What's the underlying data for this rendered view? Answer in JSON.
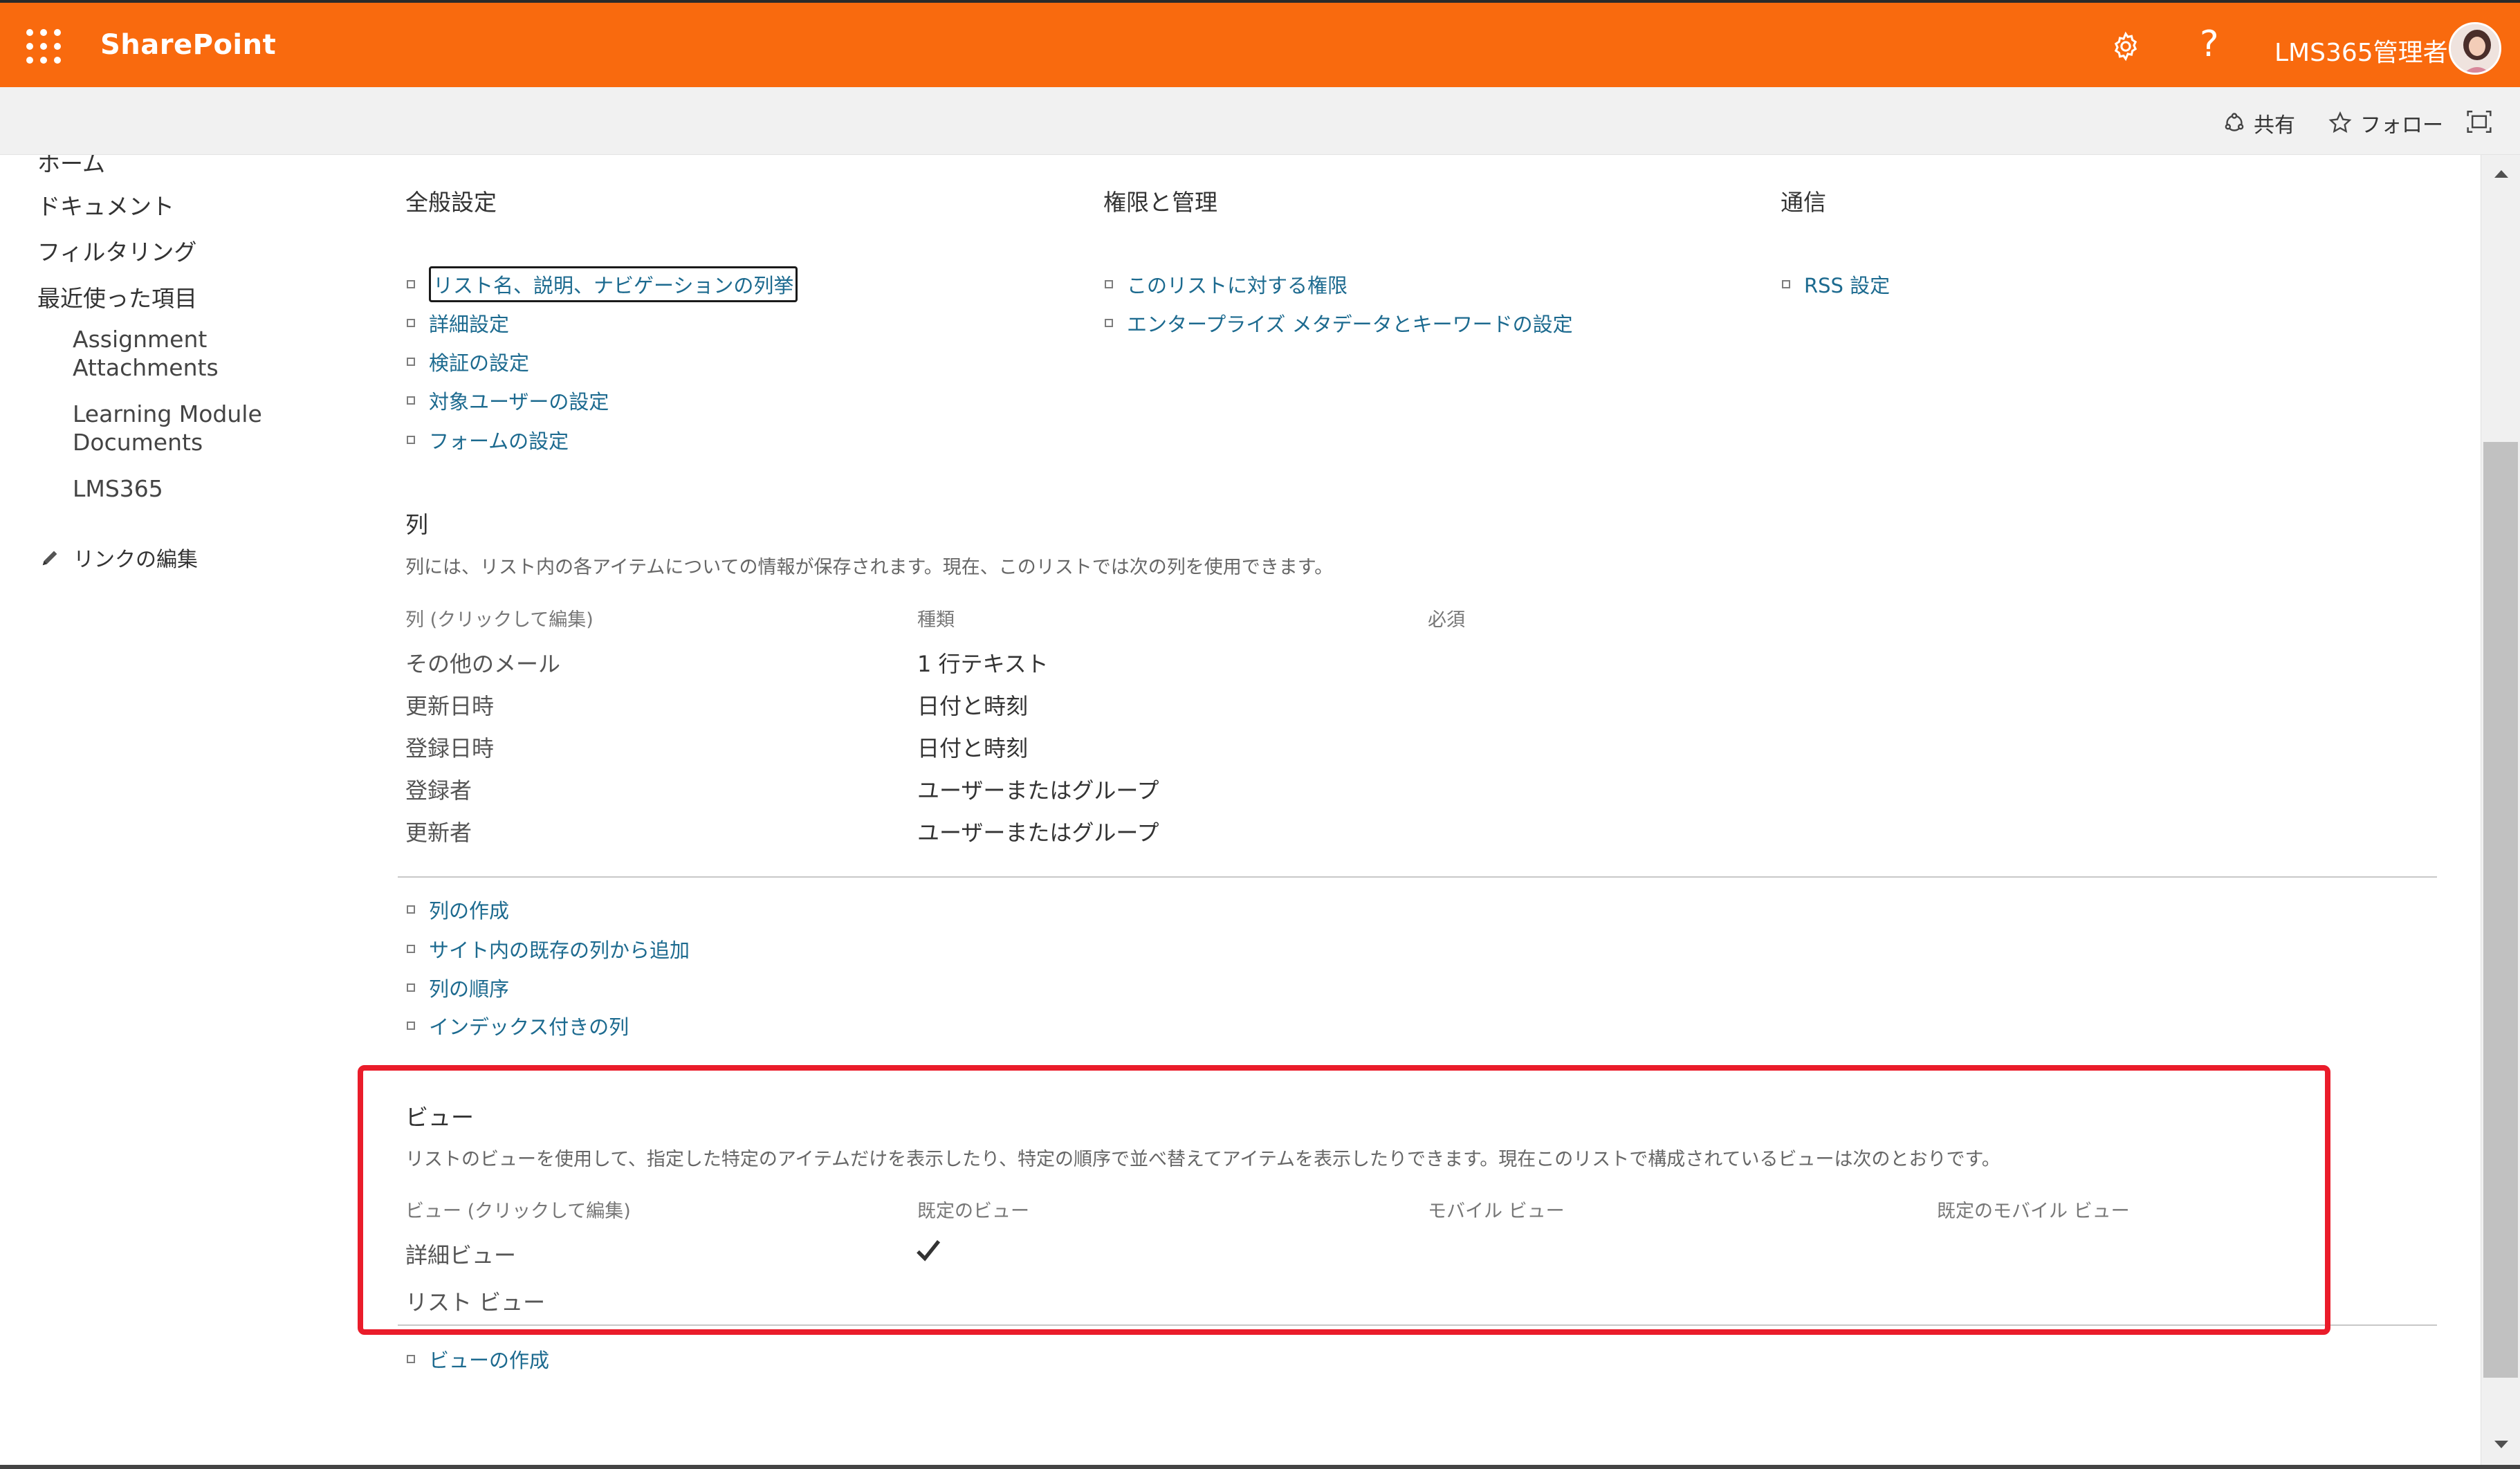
{
  "header": {
    "app_name": "SharePoint",
    "help_label": "?",
    "user_name": "LMS365管理者",
    "brand_color": "#f96a0e"
  },
  "subbar": {
    "share_label": "共有",
    "follow_label": "フォロー"
  },
  "leftnav": {
    "items": [
      {
        "label": "ホーム"
      },
      {
        "label": "ドキュメント"
      },
      {
        "label": "フィルタリング"
      },
      {
        "label": "最近使った項目"
      }
    ],
    "recent": [
      {
        "label": "Assignment Attachments"
      },
      {
        "label": "Learning Module Documents"
      },
      {
        "label": "LMS365"
      }
    ],
    "edit_links_label": "リンクの編集"
  },
  "general_settings": {
    "title": "全般設定",
    "links": [
      {
        "label": "リスト名、説明、ナビゲーションの列挙"
      },
      {
        "label": "詳細設定"
      },
      {
        "label": "検証の設定"
      },
      {
        "label": "対象ユーザーの設定"
      },
      {
        "label": "フォームの設定"
      }
    ]
  },
  "permissions": {
    "title": "権限と管理",
    "links": [
      {
        "label": "このリストに対する権限"
      },
      {
        "label": "エンタープライズ メタデータとキーワードの設定"
      }
    ]
  },
  "communication": {
    "title": "通信",
    "links": [
      {
        "label": "RSS 設定"
      }
    ]
  },
  "columns": {
    "title": "列",
    "description": "列には、リスト内の各アイテムについての情報が保存されます。現在、このリストでは次の列を使用できます。",
    "headers": [
      "列 (クリックして編集)",
      "種類",
      "必須"
    ],
    "rows": [
      {
        "name": "その他のメール",
        "type": "1 行テキスト"
      },
      {
        "name": "更新日時",
        "type": "日付と時刻"
      },
      {
        "name": "登録日時",
        "type": "日付と時刻"
      },
      {
        "name": "登録者",
        "type": "ユーザーまたはグループ"
      },
      {
        "name": "更新者",
        "type": "ユーザーまたはグループ"
      }
    ],
    "links": [
      {
        "label": "列の作成"
      },
      {
        "label": "サイト内の既存の列から追加"
      },
      {
        "label": "列の順序"
      },
      {
        "label": "インデックス付きの列"
      }
    ]
  },
  "views": {
    "title": "ビュー",
    "description": "リストのビューを使用して、指定した特定のアイテムだけを表示したり、特定の順序で並べ替えてアイテムを表示したりできます。現在このリストで構成されているビューは次のとおりです。",
    "headers": [
      "ビュー (クリックして編集)",
      "既定のビュー",
      "モバイル ビュー",
      "既定のモバイル ビュー"
    ],
    "rows": [
      {
        "name": "詳細ビュー",
        "default": true
      },
      {
        "name": "リスト ビュー",
        "default": false
      }
    ],
    "links": [
      {
        "label": "ビューの作成"
      }
    ],
    "highlight_color": "#ea1c2a"
  }
}
